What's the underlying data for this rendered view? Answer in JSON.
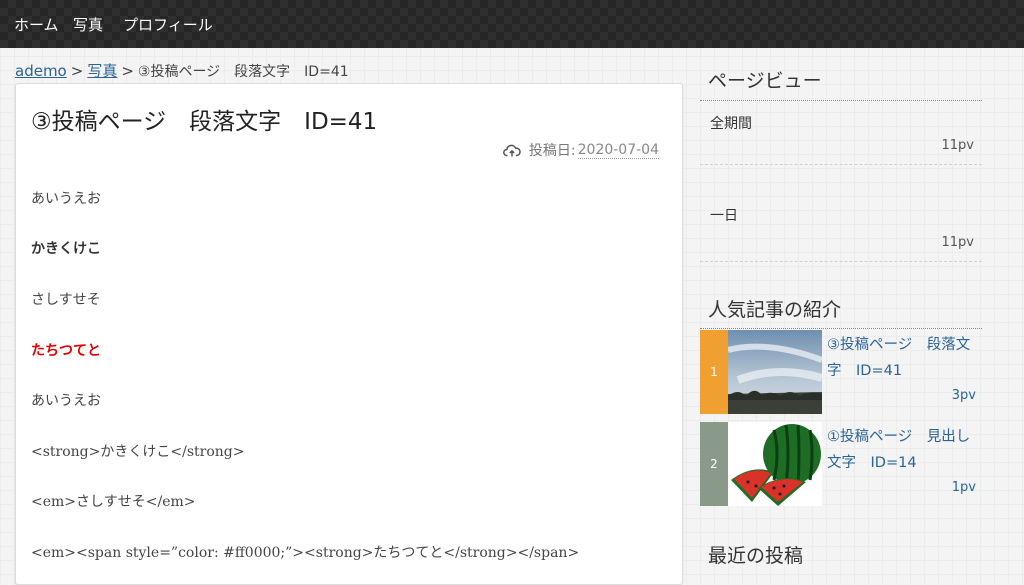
{
  "nav": {
    "items": [
      "ホーム",
      "写真",
      "プロフィール"
    ]
  },
  "breadcrumb": {
    "home": "ademo",
    "category": "写真",
    "current": "③投稿ページ　段落文字　ID=41",
    "separator": ">"
  },
  "article": {
    "title": "③投稿ページ　段落文字　ID=41",
    "date_label": "投稿日:",
    "date_value": "2020-07-04",
    "paragraphs": [
      "あいうえお",
      "かきくけこ",
      "さしすせそ",
      "たちつてと",
      "あいうえお",
      "<strong>かきくけこ</strong>",
      "<em>さしすせそ</em>",
      "<em><span style=”color: #ff0000;”><strong>たちつてと</strong></span>"
    ]
  },
  "sidebar": {
    "pageviews": {
      "heading": "ページビュー",
      "total_label": "全期間",
      "total_value": "11pv",
      "day_label": "一日",
      "day_value": "11pv"
    },
    "popular": {
      "heading": "人気記事の紹介",
      "items": [
        {
          "rank": "1",
          "title": "③投稿ページ　段落文字　ID=41",
          "pv": "3pv",
          "rank_color": "#f0a030"
        },
        {
          "rank": "2",
          "title": "①投稿ページ　見出し文字　ID=14",
          "pv": "1pv",
          "rank_color": "#8a9a8a"
        }
      ]
    },
    "recent": {
      "heading": "最近の投稿"
    }
  },
  "colors": {
    "link": "#2a6496",
    "accent_red": "#e00000",
    "nav_bg": "#262626"
  }
}
